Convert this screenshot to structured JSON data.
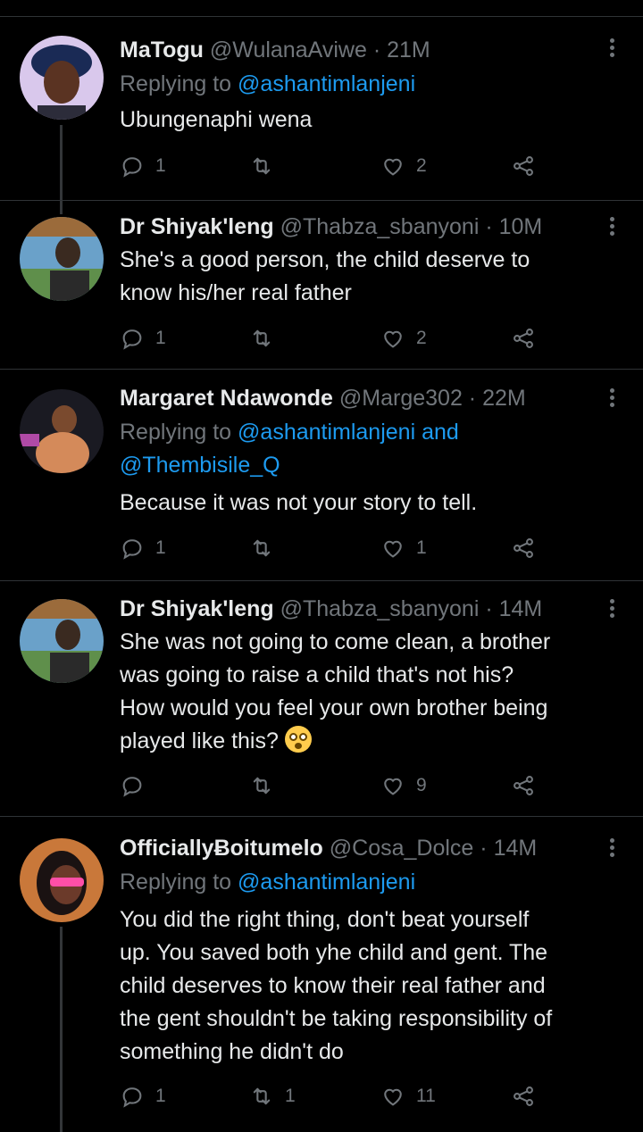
{
  "tweets": [
    {
      "name": "MaTogu",
      "handle": "@WulanaAviwe",
      "time": "21M",
      "replying_prefix": "Replying to",
      "replying_to": "@ashantimlanjeni",
      "text": [
        "Ubungenaphi wena"
      ],
      "counts": {
        "replies": "1",
        "retweets": "",
        "likes": "2"
      },
      "avatar_icon": "avatar-photo"
    },
    {
      "name": "Dr Shiyak'leng",
      "handle": "@Thabza_sbanyoni",
      "time": "10M",
      "text": [
        "She's a good person, the child deserve to",
        "know his/her real father"
      ],
      "counts": {
        "replies": "1",
        "retweets": "",
        "likes": "2"
      },
      "avatar_icon": "avatar-photo"
    },
    {
      "name": "Margaret Ndawonde",
      "handle": "@Marge302",
      "time": "22M",
      "replying_prefix": "Replying to",
      "replying_to": "@ashantimlanjeni and",
      "replying_to_2": "@Thembisile_Q",
      "text": [
        "Because it was not your story to tell."
      ],
      "counts": {
        "replies": "1",
        "retweets": "",
        "likes": "1"
      },
      "avatar_icon": "avatar-photo"
    },
    {
      "name": "Dr Shiyak'leng",
      "handle": "@Thabza_sbanyoni",
      "time": "14M",
      "text": [
        "She was not going to come clean, a brother",
        "was going to raise a child that's not his?",
        "How would you feel your own brother being",
        "played like this?"
      ],
      "emoji": "flushed-face-emoji",
      "counts": {
        "replies": "",
        "retweets": "",
        "likes": "9"
      },
      "avatar_icon": "avatar-photo"
    },
    {
      "name": "OfficiallyɃoitumelo",
      "handle": "@Cosa_Dolce",
      "time": "14M",
      "replying_prefix": "Replying to",
      "replying_to": "@ashantimlanjeni",
      "text": [
        "You did the right thing, don't beat yourself",
        "up. You saved both yhe child and gent. The",
        "child deserves to know their real father and",
        "the gent shouldn't be taking responsibility of",
        "something he didn't do"
      ],
      "counts": {
        "replies": "1",
        "retweets": "1",
        "likes": "11"
      },
      "avatar_icon": "avatar-photo"
    }
  ],
  "colors": {
    "background": "#000000",
    "text": "#e7e9ea",
    "muted": "#71767b",
    "link": "#1d9bf0",
    "divider": "#2f3336"
  },
  "icons": {
    "reply": "reply-icon",
    "retweet": "retweet-icon",
    "like": "heart-icon",
    "share": "share-icon",
    "more": "more-dots-icon"
  }
}
